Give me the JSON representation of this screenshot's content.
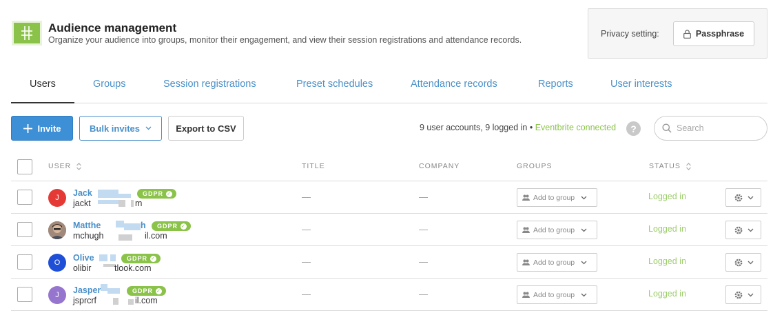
{
  "header": {
    "title": "Audience management",
    "subtitle": "Organize your audience into groups, monitor their engagement, and view their session registrations and attendance records.",
    "logo_icon": "hashtag-logo-icon",
    "privacy_label": "Privacy setting:",
    "privacy_button": "Passphrase",
    "privacy_icon": "lock-icon"
  },
  "tabs": [
    {
      "label": "Users",
      "active": true
    },
    {
      "label": "Groups"
    },
    {
      "label": "Session registrations"
    },
    {
      "label": "Preset schedules"
    },
    {
      "label": "Attendance records"
    },
    {
      "label": "Reports"
    },
    {
      "label": "User interests"
    }
  ],
  "toolbar": {
    "invite_label": "Invite",
    "bulk_label": "Bulk invites",
    "csv_label": "Export to CSV",
    "summary": "9 user accounts, 9 logged in •",
    "eventbrite": "Eventbrite connected",
    "help": "?",
    "search_placeholder": "Search"
  },
  "table": {
    "columns": [
      "USER",
      "TITLE",
      "COMPANY",
      "GROUPS",
      "STATUS"
    ],
    "rows": [
      {
        "name": "Jack",
        "email": "jackt",
        "email_end": "m",
        "avatar": "J",
        "avatar_color": "#e53935",
        "gdpr": "GDPR",
        "title": "—",
        "company": "—",
        "group": "Add to group",
        "status": "Logged in"
      },
      {
        "name": "Matthe",
        "name_end": "h",
        "email": "mchugh",
        "email_end": "il.com",
        "avatar": "",
        "avatar_color": "#8d6e63",
        "gdpr": "GDPR",
        "title": "—",
        "company": "—",
        "group": "Add to group",
        "status": "Logged in"
      },
      {
        "name": "Olive",
        "email": "olibir",
        "email_end": "tlook.com",
        "avatar": "O",
        "avatar_color": "#1e4fd6",
        "gdpr": "GDPR",
        "title": "—",
        "company": "—",
        "group": "Add to group",
        "status": "Logged in"
      },
      {
        "name": "Jasper",
        "email": "jsprcrf",
        "email_end": "il.com",
        "avatar": "J",
        "avatar_color": "#9575cd",
        "gdpr": "GDPR",
        "title": "—",
        "company": "—",
        "group": "Add to group",
        "status": "Logged in"
      }
    ]
  },
  "colors": {
    "accent_blue": "#4a90c8",
    "primary_button": "#3d8fd6",
    "green": "#8bc34a",
    "status_green": "#9ccd6a"
  }
}
